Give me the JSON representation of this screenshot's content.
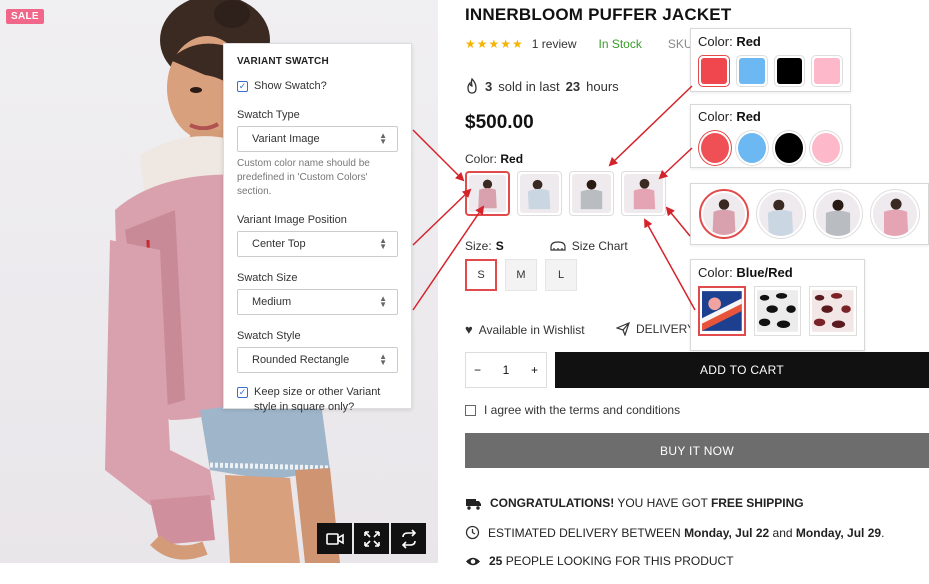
{
  "product": {
    "badge": "SALE",
    "title": "INNERBLOOM PUFFER JACKET",
    "rating_stars": "★★★★★",
    "reviews": "1 review",
    "stock": "In Stock",
    "sku_label": "SKU",
    "sold_count": "3",
    "sold_mid": "sold in last",
    "sold_hours": "23",
    "sold_end": "hours",
    "price": "$500.00",
    "color_label": "Color:",
    "color_value": "Red",
    "size_label": "Size:",
    "size_value": "S",
    "size_chart": "Size Chart",
    "sizes": [
      "S",
      "M",
      "L"
    ],
    "wishlist": "Available in Wishlist",
    "delivery": "DELIVERY",
    "qty_minus": "−",
    "qty_value": "1",
    "qty_plus": "+",
    "add_to_cart": "ADD TO CART",
    "terms": "I agree with the terms and conditions",
    "buy_now": "BUY IT NOW",
    "shipping_bold": "CONGRATULATIONS!",
    "shipping_text": "YOU HAVE GOT",
    "shipping_free": "FREE SHIPPING",
    "est_text": "ESTIMATED DELIVERY BETWEEN",
    "est_from": "Monday, Jul 22",
    "est_and": "and",
    "est_to": "Monday, Jul 29",
    "est_dot": ".",
    "viewers_count": "25",
    "viewers_text": "PEOPLE LOOKING FOR THIS PRODUCT"
  },
  "panel": {
    "title": "VARIANT SWATCH",
    "show_swatch": "Show Swatch?",
    "swatch_type_label": "Swatch Type",
    "swatch_type_value": "Variant Image",
    "help": "Custom color name should be predefined in 'Custom Colors' section.",
    "position_label": "Variant Image Position",
    "position_value": "Center Top",
    "size_label": "Swatch Size",
    "size_value": "Medium",
    "style_label": "Swatch Style",
    "style_value": "Rounded Rectangle",
    "square_option": "Keep size or other Variant style in square only?"
  },
  "callouts": {
    "square": {
      "label": "Color:",
      "value": "Red",
      "colors": [
        "#f0474e",
        "#6bb8f2",
        "#000000",
        "#fdb9c9"
      ]
    },
    "circle": {
      "label": "Color:",
      "value": "Red",
      "colors": [
        "#ef5056",
        "#6bb8f2",
        "#000000",
        "#fdb9c9"
      ]
    },
    "pattern": {
      "label": "Color:",
      "value": "Blue/Red"
    }
  },
  "accent": "#e14b4b"
}
